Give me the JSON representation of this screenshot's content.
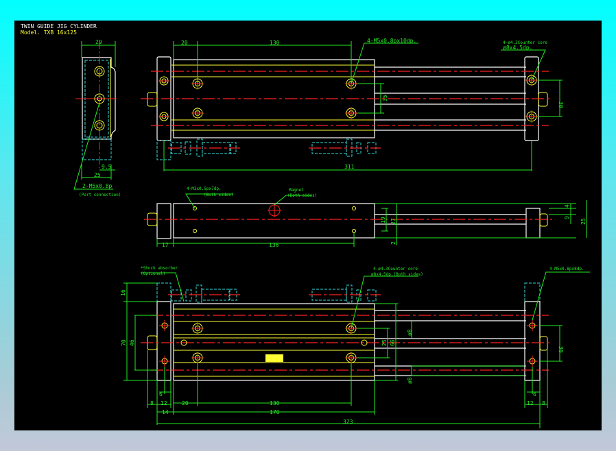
{
  "title": "TWIN GUIDE JIG CYLINDER",
  "model": "Model. TXB 16x125",
  "colors": {
    "background": "#000000",
    "outline": "#ffffff",
    "hidden": "#33dddd",
    "centerline": "#ff2020",
    "dimension": "#22ee22",
    "detail": "#ffff33",
    "frame": "#00ffff"
  },
  "side_view": {
    "dim_width": "29",
    "dim_9_5": "9.5",
    "dim_25": "25",
    "note": "2-M5x0.8p",
    "note_sub": "(Port connection)"
  },
  "top_view": {
    "dim_20": "20",
    "dim_130": "130",
    "dim_311": "311",
    "dim_35": "35",
    "dim_30": "30",
    "note_left": "4-M5x0.8px10dp.",
    "note_right_1": "4-ø4.3Counter core",
    "note_right_2": "ø8x4.5dp."
  },
  "middle_view": {
    "note_1": "4-M3x0.5px7dp.",
    "note_1_sub": "(Both sides)",
    "note_2": "Magnet",
    "note_2_sub": "(Both sides)",
    "dim_17": "17",
    "dim_136": "136",
    "dim_19": "19",
    "dim_27": "27",
    "dim_2": "2",
    "dim_4": "4",
    "dim_9": "9",
    "dim_25": "25"
  },
  "bottom_view": {
    "note_shock": "*Shock absorber",
    "note_shock_sub": "(Optional)",
    "note_cb_1": "4-ø4.3Counter core",
    "note_cb_2": "ø8x4.5dp.(Both sides)",
    "note_right": "4-M5x0.8px8dp.",
    "dim_16": "16",
    "dim_70": "70",
    "dim_46": "46",
    "dim_25": "25",
    "dim_66": "66",
    "dim_d8a": "ø8",
    "dim_d8b": "ø8",
    "dim_30": "30",
    "dim_8": "8",
    "dim_12": "12",
    "dim_6": "6",
    "dim_14": "14",
    "dim_20": "20",
    "dim_130": "130",
    "dim_170": "170",
    "dim_323": "323",
    "dim_r6": "6",
    "dim_r12": "12",
    "dim_r8": "8"
  }
}
